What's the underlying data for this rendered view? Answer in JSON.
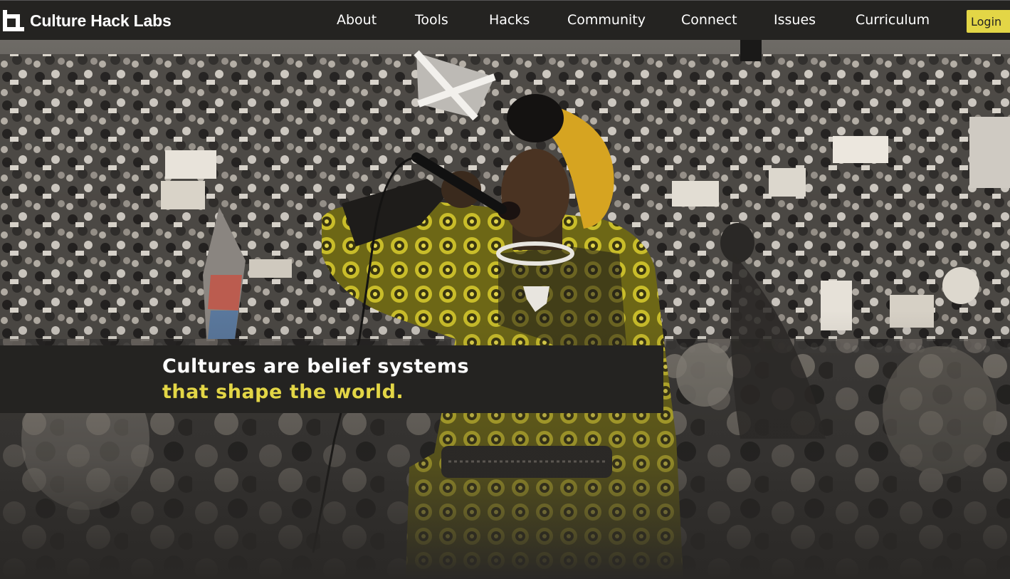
{
  "brand": {
    "name": "Culture Hack Labs",
    "accent": "#e3d646",
    "dark": "#242321"
  },
  "nav": {
    "items": [
      {
        "label": "About"
      },
      {
        "label": "Tools"
      },
      {
        "label": "Hacks"
      },
      {
        "label": "Community"
      },
      {
        "label": "Connect"
      },
      {
        "label": "Issues"
      },
      {
        "label": "Curriculum"
      }
    ],
    "login_label": "Login"
  },
  "hero": {
    "line1": "Cultures are belief systems",
    "line2": "that shape the world."
  }
}
